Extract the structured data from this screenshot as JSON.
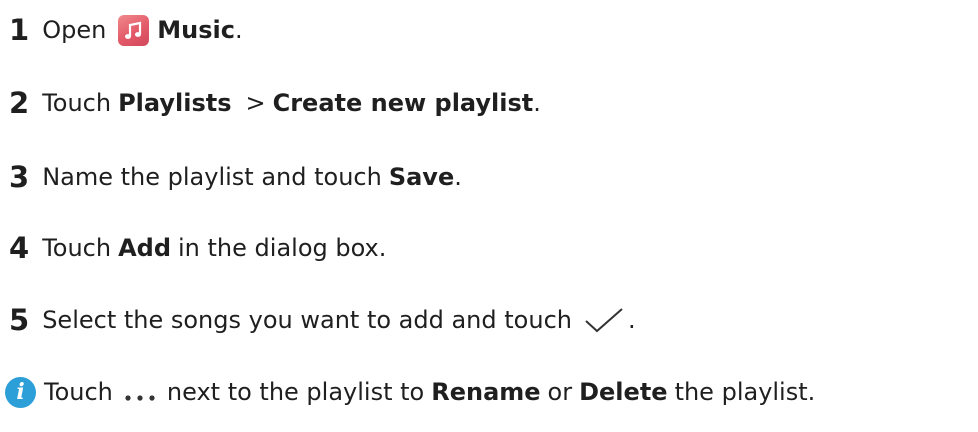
{
  "steps": [
    {
      "num": "1",
      "pre": "Open",
      "bold": "Music",
      "post": "."
    },
    {
      "num": "2",
      "pre": "Touch",
      "bold1": "Playlists",
      "sep": ">",
      "bold2": "Create new playlist",
      "post": "."
    },
    {
      "num": "3",
      "pre": "Name the playlist and touch",
      "bold": "Save",
      "post": "."
    },
    {
      "num": "4",
      "pre": "Touch",
      "bold": "Add",
      "post": "in the dialog box."
    },
    {
      "num": "5",
      "pre": "Select the songs you want to add and touch",
      "post": "."
    }
  ],
  "note": {
    "pre": "Touch",
    "mid": "next to the playlist to",
    "bold1": "Rename",
    "or": "or",
    "bold2": "Delete",
    "post": "the playlist."
  },
  "icons": {
    "music": "music-app-icon",
    "check": "checkmark-icon",
    "info": "info-icon",
    "more": "more-options-icon",
    "info_glyph": "i"
  },
  "colors": {
    "text": "#1f1f1f",
    "music_icon": "#e35a69",
    "info_icon": "#2d9fd8"
  }
}
